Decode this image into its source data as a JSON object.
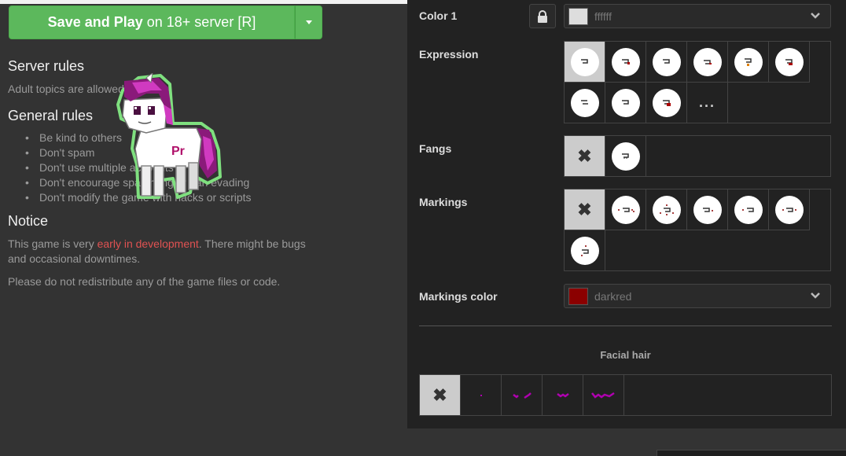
{
  "left": {
    "play_main": "Save and Play",
    "play_rest": "on 18+ server [R]",
    "server_rules_title": "Server rules",
    "server_rules_text": "Adult topics are allowed",
    "general_rules_title": "General rules",
    "rules": [
      "Be kind to others",
      "Don't spam",
      "Don't use multiple accounts",
      "Don't encourage spamming or ban evading",
      "Don't modify the game with hacks or scripts"
    ],
    "notice_title": "Notice",
    "notice_pre": "This game is very ",
    "notice_link": "early in development",
    "notice_post": ". There might be bugs",
    "notice_line2": "and occasional downtimes.",
    "notice_p2": "Please do not redistribute any of the game files or code."
  },
  "panel": {
    "color1_label": "Color 1",
    "color1_value": "ffffff",
    "color1_swatch": "#dddddd",
    "expression_label": "Expression",
    "more_label": "...",
    "fangs_label": "Fangs",
    "markings_label": "Markings",
    "markings_color_label": "Markings color",
    "markings_color_value": "darkred",
    "markings_color_swatch": "#8b0000",
    "facial_hair_title": "Facial hair"
  },
  "icons": {
    "lock": "lock-icon",
    "chevron": "chevron-down-icon",
    "none": "x-icon"
  },
  "colors": {
    "accent_green": "#5cb85c",
    "link_red": "#e05252",
    "facial_hair": "#b000b0",
    "selected_cell": "#cccccc"
  }
}
